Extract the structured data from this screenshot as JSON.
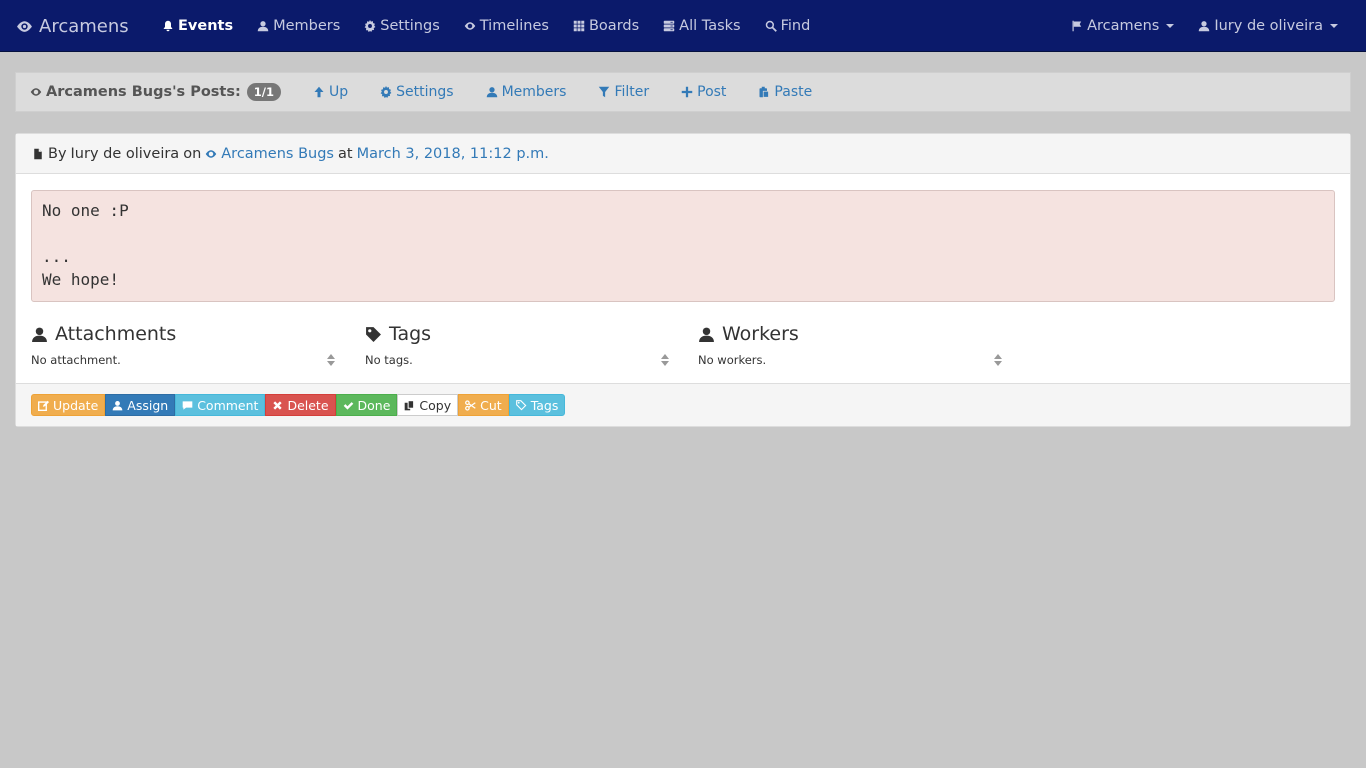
{
  "navbar": {
    "brand": "Arcamens",
    "items": [
      {
        "label": "Events",
        "icon": "bell-icon"
      },
      {
        "label": "Members",
        "icon": "user-icon"
      },
      {
        "label": "Settings",
        "icon": "gear-icon"
      },
      {
        "label": "Timelines",
        "icon": "eye-icon"
      },
      {
        "label": "Boards",
        "icon": "grid-icon"
      },
      {
        "label": "All Tasks",
        "icon": "tasks-icon"
      },
      {
        "label": "Find",
        "icon": "search-icon"
      }
    ],
    "org_menu": "Arcamens",
    "user_menu": "Iury de oliveira"
  },
  "header": {
    "title": "Arcamens Bugs's Posts:",
    "badge": "1/1",
    "links": [
      "Up",
      "Settings",
      "Members",
      "Filter",
      "Post",
      "Paste"
    ]
  },
  "post": {
    "by_prefix": "By",
    "author": "Iury de oliveira",
    "on": "on",
    "timeline": "Arcamens Bugs",
    "at": "at",
    "date": "March 3, 2018, 11:12 p.m.",
    "content": "No one :P\n\n...\nWe hope!",
    "attachments_title": "Attachments",
    "attachments_empty": "No attachment.",
    "tags_title": "Tags",
    "tags_empty": "No tags.",
    "workers_title": "Workers",
    "workers_empty": "No workers."
  },
  "actions": [
    "Update",
    "Assign",
    "Comment",
    "Delete",
    "Done",
    "Copy",
    "Cut",
    "Tags"
  ]
}
